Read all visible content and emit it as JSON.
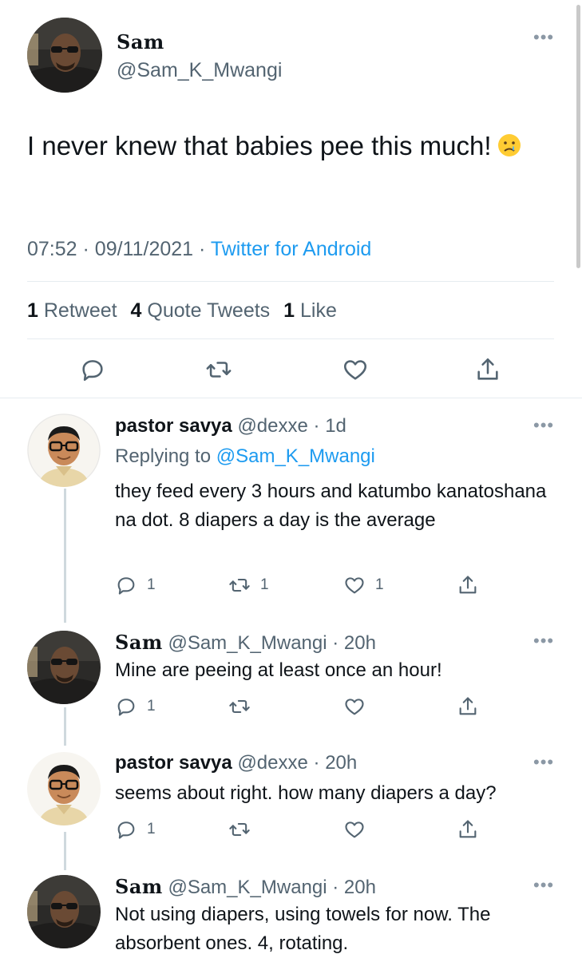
{
  "main_tweet": {
    "name": "Sam",
    "handle": "@Sam_K_Mwangi",
    "text": "I never knew that babies pee this much!",
    "time": "07:52",
    "date": "09/11/2021",
    "source": "Twitter for Android",
    "stats": {
      "retweets_count": "1",
      "retweets_label": "Retweet",
      "quote_count": "4",
      "quote_label": "Quote Tweets",
      "likes_count": "1",
      "likes_label": "Like"
    }
  },
  "replies": [
    {
      "name": "pastor savya",
      "handle": "@dexxe",
      "age": "1d",
      "replying_prefix": "Replying to",
      "replying_to": "@Sam_K_Mwangi",
      "text": "they feed every 3 hours and katumbo kanatoshana na dot. 8 diapers a day is the average",
      "reply_count": "1",
      "retweet_count": "1",
      "like_count": "1"
    },
    {
      "name": "Sam",
      "handle": "@Sam_K_Mwangi",
      "age": "20h",
      "text": "Mine are peeing at least once an hour!",
      "reply_count": "1",
      "retweet_count": "",
      "like_count": ""
    },
    {
      "name": "pastor savya",
      "handle": "@dexxe",
      "age": "20h",
      "text": "seems about right. how many diapers a day?",
      "reply_count": "1",
      "retweet_count": "",
      "like_count": ""
    },
    {
      "name": "Sam",
      "handle": "@Sam_K_Mwangi",
      "age": "20h",
      "text": "Not using diapers, using towels for now. The absorbent ones. 4, rotating."
    }
  ],
  "icons": {
    "more": "more-icon",
    "reply": "reply-icon",
    "retweet": "retweet-icon",
    "like": "heart-icon",
    "share": "share-icon",
    "emoji": "crying-face-emoji"
  },
  "colors": {
    "link": "#1d9bf0",
    "muted": "#536471",
    "text": "#0f1419",
    "border": "#e6ecf0"
  }
}
